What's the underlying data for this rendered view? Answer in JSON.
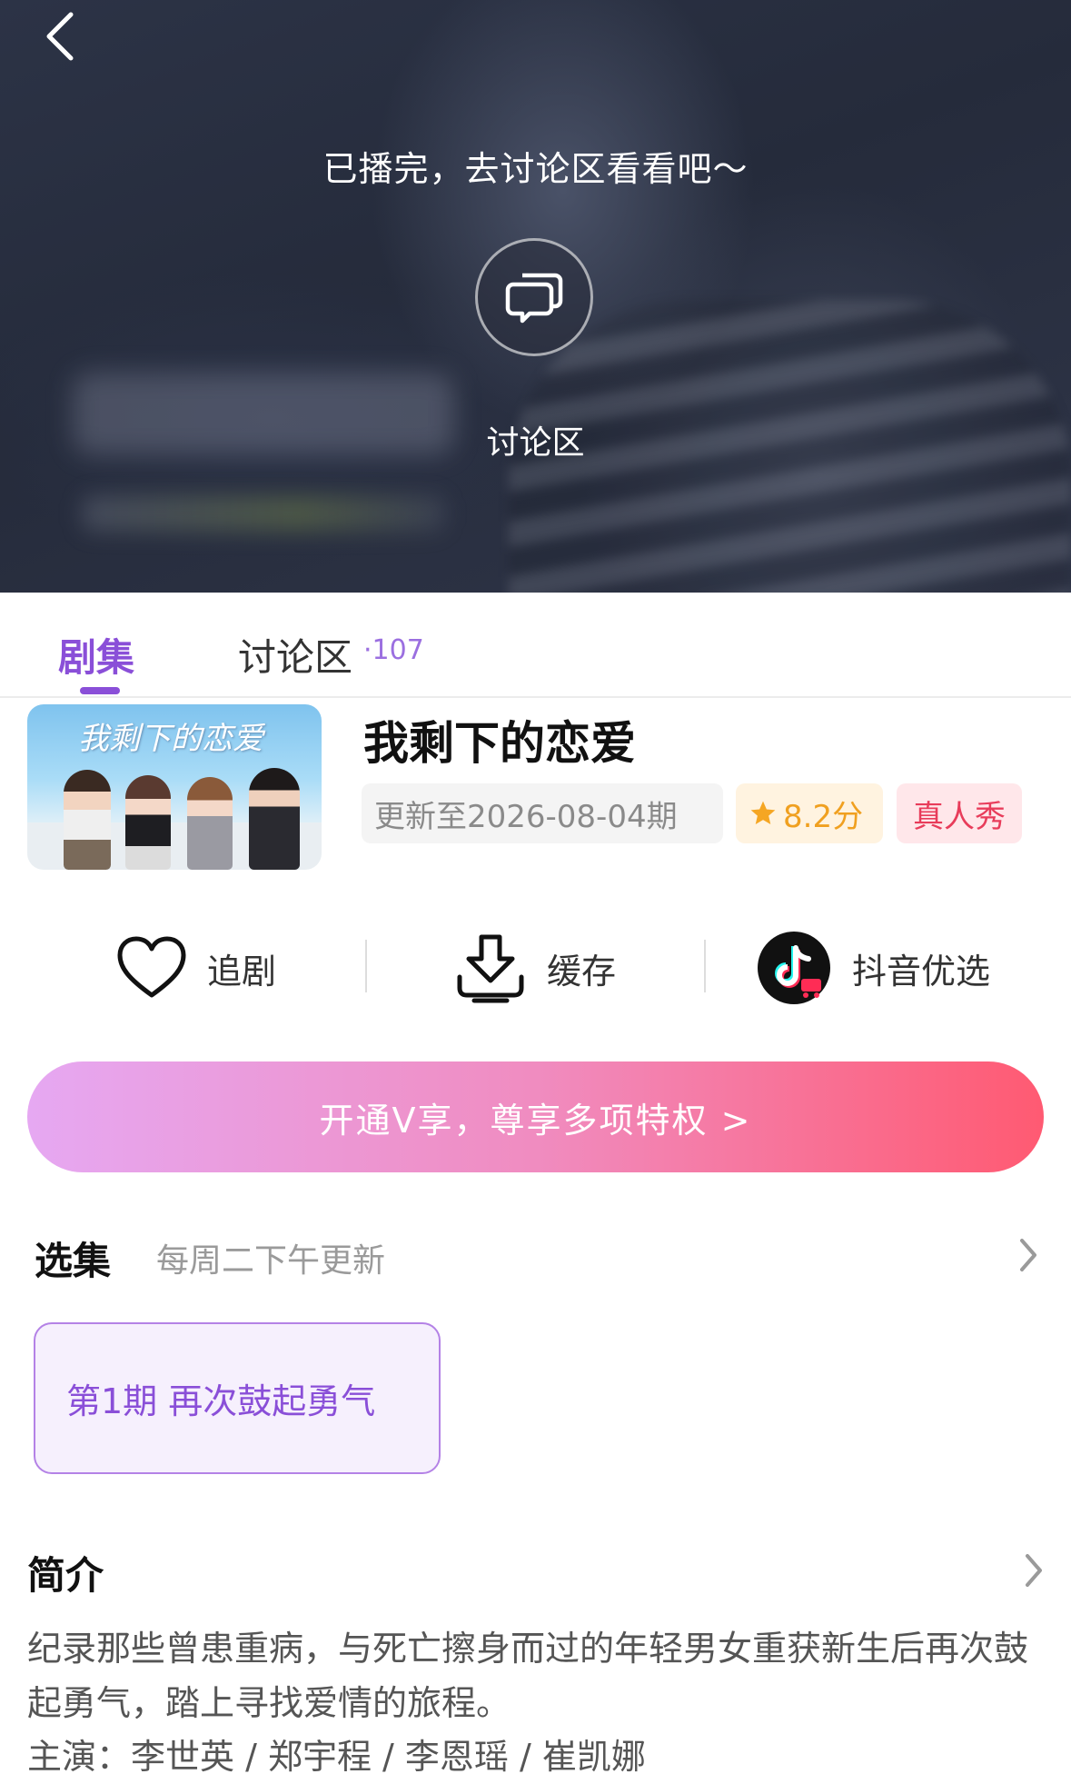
{
  "player": {
    "ended_text": "已播完，去讨论区看看吧～",
    "discuss_label": "讨论区"
  },
  "tabs": {
    "episodes": "剧集",
    "discussion": "讨论区",
    "discussion_count": "·107"
  },
  "show": {
    "poster_title": "我剩下的恋爱",
    "title": "我剩下的恋爱",
    "update_badge": "更新至2026-08-04期",
    "score": "8.2分",
    "genre": "真人秀"
  },
  "actions": {
    "follow": "追剧",
    "download": "缓存",
    "douyin": "抖音优选"
  },
  "vip_banner": "开通V享，尊享多项特权 >",
  "episodes": {
    "title": "选集",
    "schedule": "每周二下午更新",
    "items": [
      {
        "label": "第1期  再次鼓起勇气"
      }
    ]
  },
  "intro": {
    "title": "简介",
    "text": "纪录那些曾患重病，与死亡擦身而过的年轻男女重获新生后再次鼓起勇气，踏上寻找爱情的旅程。",
    "cast": "主演：李世英 / 郑宇程 / 李恩瑶 / 崔凯娜"
  },
  "colors": {
    "accent": "#8a4fd8",
    "score": "#f0a020",
    "genre": "#e83c5a",
    "vip_start": "#e6a8f2",
    "vip_end": "#ff5a72"
  },
  "icons": {
    "back": "chevron-left-icon",
    "discuss": "chat-bubbles-icon",
    "follow": "heart-icon",
    "download": "download-icon",
    "douyin": "douyin-logo-icon",
    "star": "star-icon",
    "more": "chevron-right-icon"
  }
}
